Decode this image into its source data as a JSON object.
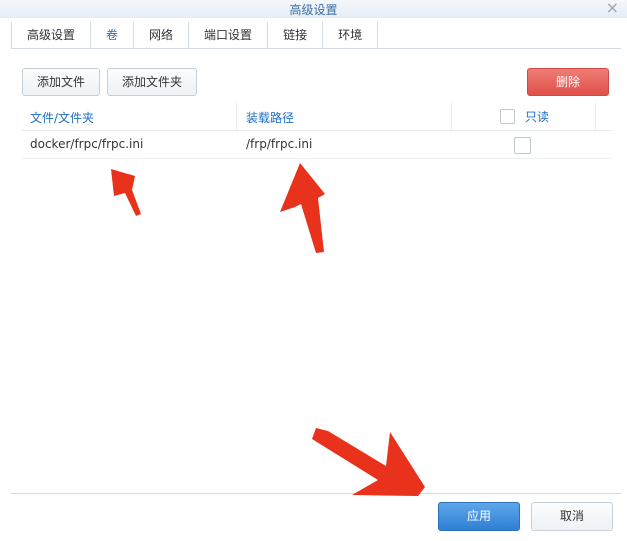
{
  "window": {
    "title": "高级设置",
    "close_glyph": "×"
  },
  "tabs": [
    {
      "label": "高级设置",
      "active": false
    },
    {
      "label": "卷",
      "active": true
    },
    {
      "label": "网络",
      "active": false
    },
    {
      "label": "端口设置",
      "active": false
    },
    {
      "label": "链接",
      "active": false
    },
    {
      "label": "环境",
      "active": false
    }
  ],
  "toolbar": {
    "add_file": "添加文件",
    "add_folder": "添加文件夹",
    "delete": "删除"
  },
  "table": {
    "columns": [
      "文件/文件夹",
      "装载路径",
      "只读"
    ],
    "rows": [
      {
        "file": "docker/frpc/frpc.ini",
        "mount": "/frp/frpc.ini",
        "readonly": false
      }
    ]
  },
  "footer": {
    "apply": "应用",
    "cancel": "取消"
  },
  "colors": {
    "accent": "#1f6dc4",
    "danger": "#e0504a",
    "primary": "#2e7fd3",
    "annotation": "#e8321c"
  }
}
